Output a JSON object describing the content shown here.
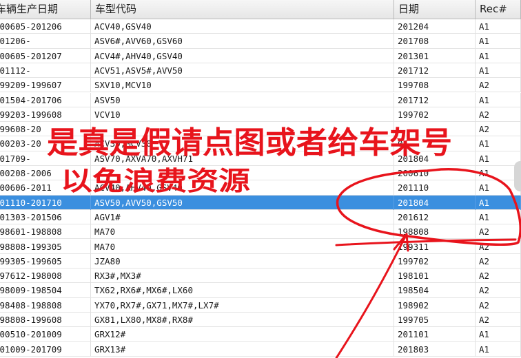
{
  "table": {
    "columns": [
      "车辆生产日期",
      "车型代码",
      "日期",
      "Rec#"
    ],
    "rows": [
      {
        "production_date": "200605-201206",
        "model_code": "ACV40,GSV40",
        "date": "201204",
        "rec": "A1"
      },
      {
        "production_date": "201206-",
        "model_code": "ASV6#,AVV60,GSV60",
        "date": "201708",
        "rec": "A1"
      },
      {
        "production_date": "200605-201207",
        "model_code": "ACV4#,AHV40,GSV40",
        "date": "201301",
        "rec": "A1"
      },
      {
        "production_date": "201112-",
        "model_code": "ACV51,ASV5#,AVV50",
        "date": "201712",
        "rec": "A1"
      },
      {
        "production_date": "199209-199607",
        "model_code": "SXV10,MCV10",
        "date": "199708",
        "rec": "A2"
      },
      {
        "production_date": "201504-201706",
        "model_code": "ASV50",
        "date": "201712",
        "rec": "A1"
      },
      {
        "production_date": "199203-199608",
        "model_code": "VCV10",
        "date": "199702",
        "rec": "A2"
      },
      {
        "production_date": "199608-20",
        "model_code": "",
        "date": "",
        "rec": "A2"
      },
      {
        "production_date": "200203-20",
        "model_code": "ACV30,MCV30",
        "date": "04",
        "rec": "A1"
      },
      {
        "production_date": "201709-",
        "model_code": "ASV70,AXVA70,AXVH71",
        "date": "201804",
        "rec": "A1"
      },
      {
        "production_date": "200208-2006",
        "model_code": "",
        "date": "200610",
        "rec": "A1"
      },
      {
        "production_date": "200606-2011",
        "model_code": "ACV40,AHV40,GSV40",
        "date": "201110",
        "rec": "A1"
      },
      {
        "production_date": "201110-201710",
        "model_code": "ASV50,AVV50,GSV50",
        "date": "201804",
        "rec": "A1",
        "selected": true
      },
      {
        "production_date": "201303-201506",
        "model_code": "AGV1#",
        "date": "201612",
        "rec": "A1"
      },
      {
        "production_date": "198601-198808",
        "model_code": "MA70",
        "date": "198808",
        "rec": "A2"
      },
      {
        "production_date": "198808-199305",
        "model_code": "MA70",
        "date": "199311",
        "rec": "A2"
      },
      {
        "production_date": "199305-199605",
        "model_code": "JZA80",
        "date": "199702",
        "rec": "A2"
      },
      {
        "production_date": "197612-198008",
        "model_code": "RX3#,MX3#",
        "date": "198101",
        "rec": "A2"
      },
      {
        "production_date": "198009-198504",
        "model_code": "TX62,RX6#,MX6#,LX60",
        "date": "198504",
        "rec": "A2"
      },
      {
        "production_date": "198408-198808",
        "model_code": "YX70,RX7#,GX71,MX7#,LX7#",
        "date": "198902",
        "rec": "A2"
      },
      {
        "production_date": "198808-199608",
        "model_code": "GX81,LX80,MX8#,RX8#",
        "date": "199705",
        "rec": "A2"
      },
      {
        "production_date": "200510-201009",
        "model_code": "GRX12#",
        "date": "201101",
        "rec": "A1"
      },
      {
        "production_date": "201009-201709",
        "model_code": "GRX13#",
        "date": "201803",
        "rec": "A1"
      }
    ]
  },
  "annotation": {
    "line1": "是真是假请点图或者给车架号",
    "line2": "以免浪费资源",
    "color": "#e8141c"
  },
  "colors": {
    "selection": "#3b8fdf",
    "header_bg": "#ececec"
  }
}
